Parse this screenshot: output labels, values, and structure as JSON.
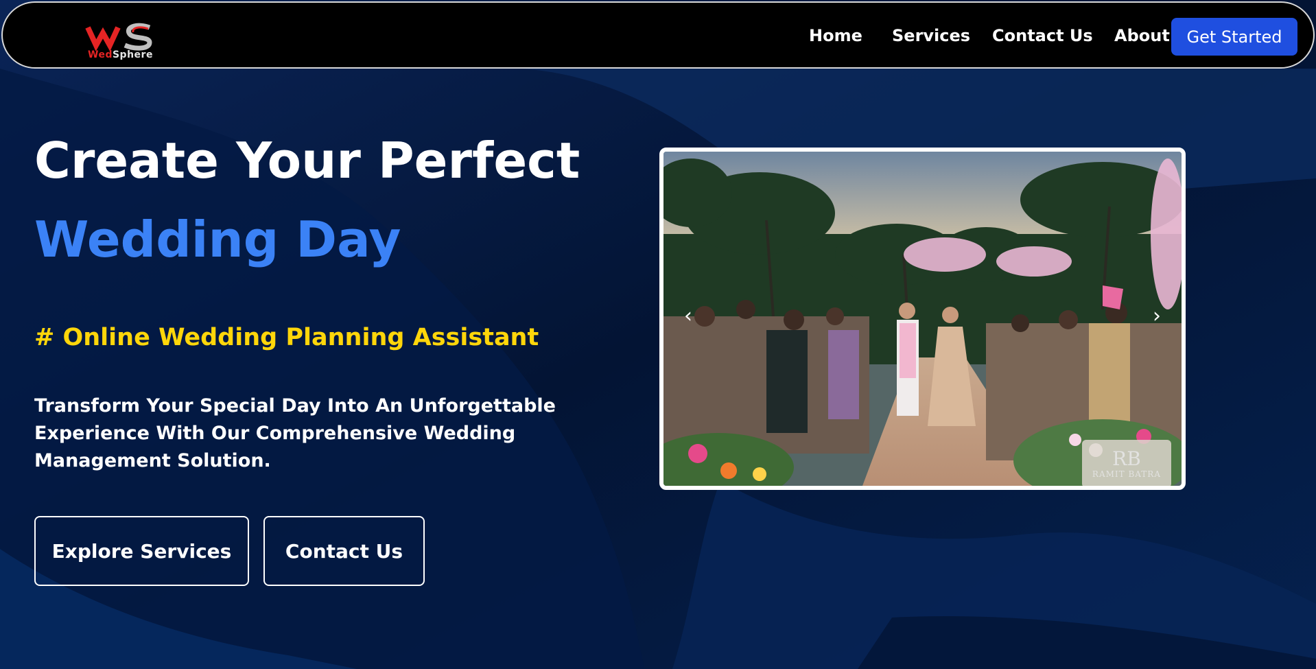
{
  "brand": {
    "name_part1": "Wed",
    "name_part2": "Sphere",
    "logo_icon": "ws-logo-icon"
  },
  "nav": {
    "items": [
      {
        "label": "Home"
      },
      {
        "label": "Services"
      },
      {
        "label": "Contact Us"
      },
      {
        "label": "About"
      }
    ],
    "cta_label": "Get Started"
  },
  "hero": {
    "title_line1": "Create Your Perfect",
    "title_line2": "Wedding Day",
    "tagline": "# Online Wedding Planning Assistant",
    "description": "Transform Your Special Day Into An Unforgettable Experience With Our Comprehensive Wedding Management Solution.",
    "primary_button": "Explore Services",
    "secondary_button": "Contact Us"
  },
  "carousel": {
    "prev_icon": "‹",
    "next_icon": "›",
    "watermark_mark": "RB",
    "watermark_credit": "RAMIT BATRA"
  },
  "colors": {
    "background": "#061a44",
    "accent_blue": "#3b82f6",
    "button_blue": "#1f4fe0",
    "tagline_yellow": "#ffd60a",
    "logo_red": "#e52424"
  }
}
